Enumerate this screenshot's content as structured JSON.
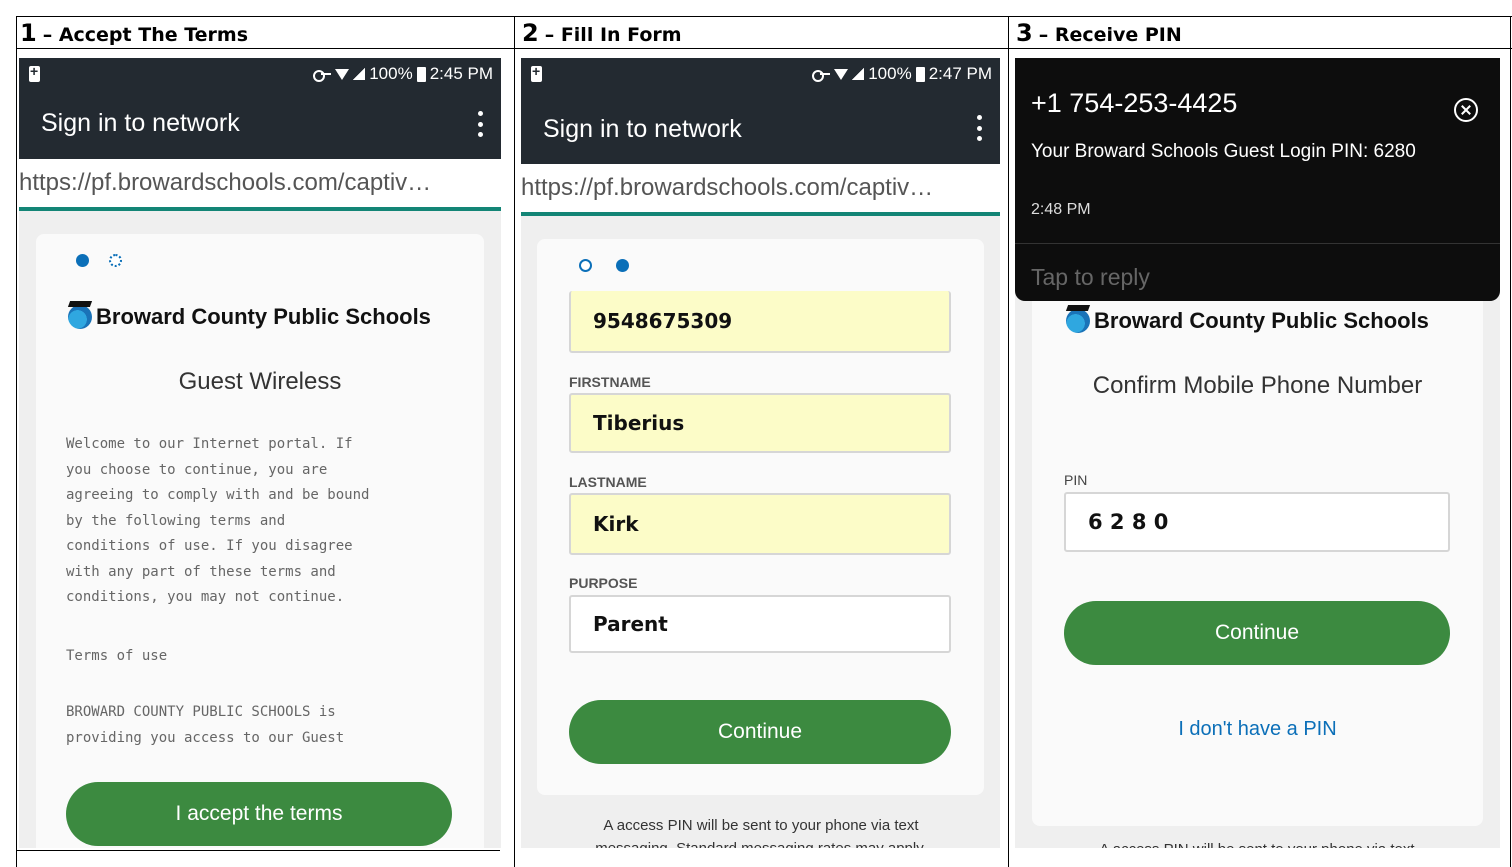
{
  "steps": [
    {
      "num": "1",
      "title": "– Accept The Terms"
    },
    {
      "num": "2",
      "title": "– Fill In Form"
    },
    {
      "num": "3",
      "title": "– Receive PIN"
    }
  ],
  "panel1": {
    "status_right": "100%",
    "time": "2:45 PM",
    "appbar_title": "Sign in to network",
    "url": "https://pf.browardschools.com/captiv…",
    "brand": "Broward County Public Schools",
    "subtitle": "Guest Wireless",
    "terms_text": "Welcome to our Internet portal. If\nyou choose to continue, you are\nagreeing to comply with and be bound\nby the following terms and\nconditions of use. If you disagree\nwith any part of these terms and\nconditions, you may not continue.",
    "terms_heading": "Terms of use",
    "terms_text2": "BROWARD COUNTY PUBLIC SCHOOLS is\nproviding you access to our Guest",
    "button": "I accept the terms"
  },
  "panel2": {
    "status_right": "100%",
    "time": "2:47 PM",
    "appbar_title": "Sign in to network",
    "url": "https://pf.browardschools.com/captiv…",
    "phone_value": "9548675309",
    "firstname_label": "FIRSTNAME",
    "firstname_value": "Tiberius",
    "lastname_label": "LASTNAME",
    "lastname_value": "Kirk",
    "purpose_label": "PURPOSE",
    "purpose_value": "Parent",
    "button": "Continue",
    "note": "A access PIN will be sent to your phone via text messaging. Standard messaging rates may apply."
  },
  "panel3": {
    "notif_phone": "+1 754-253-4425",
    "notif_msg": "Your Broward Schools Guest Login PIN: 6280",
    "notif_time": "2:48 PM",
    "notif_reply": "Tap to reply",
    "brand": "Broward County Public Schools",
    "subtitle": "Confirm Mobile Phone Number",
    "pin_label": "PIN",
    "pin_value": "6 2 8 0",
    "button": "Continue",
    "link": "I don't have a PIN",
    "note": "A access PIN will be sent to your phone via text"
  },
  "colors": {
    "accent_green": "#3c8a40",
    "link_blue": "#0b6fb8",
    "appbar": "#232a31",
    "autofill": "#fcfcc8"
  }
}
